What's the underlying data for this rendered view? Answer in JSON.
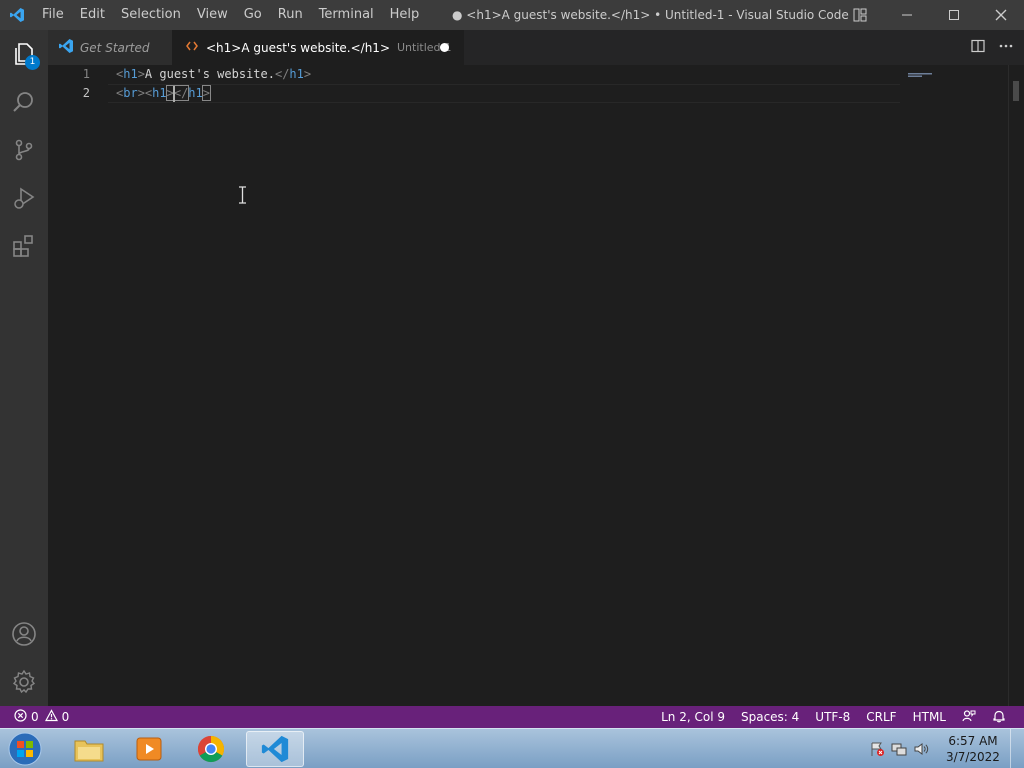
{
  "titlebar": {
    "menu": [
      "File",
      "Edit",
      "Selection",
      "View",
      "Go",
      "Run",
      "Terminal",
      "Help"
    ],
    "window_title": "● <h1>A guest's website.</h1> • Untitled-1 - Visual Studio Code"
  },
  "activitybar": {
    "explorer_badge": "1",
    "icons": [
      "files-icon",
      "search-icon",
      "source-control-icon",
      "run-debug-icon",
      "extensions-icon",
      "account-icon",
      "settings-gear-icon"
    ]
  },
  "tabs": [
    {
      "label": "Get Started",
      "active": false
    },
    {
      "label": "<h1>A guest's website.</h1>",
      "description": "Untitled-1",
      "active": true,
      "dirty": true
    }
  ],
  "editor": {
    "line_numbers": [
      "1",
      "2"
    ],
    "lines": [
      {
        "open_lt": "<",
        "open_tag": "h1",
        "open_gt": ">",
        "text": "A guest's website.",
        "close_lt": "</",
        "close_tag": "h1",
        "close_gt": ">"
      },
      {
        "br_lt": "<",
        "br_tag": "br",
        "br_gt": ">",
        "h1_lt": "<",
        "h1_tag": "h1",
        "h1_gt": ">",
        "close_lt": "</",
        "close_tag": "h1",
        "close_gt": ">"
      }
    ]
  },
  "statusbar": {
    "errors": "0",
    "warnings": "0",
    "position": "Ln 2, Col 9",
    "spaces": "Spaces: 4",
    "encoding": "UTF-8",
    "eol": "CRLF",
    "language": "HTML",
    "background": "#68217a"
  },
  "taskbar": {
    "apps": [
      "file-explorer-icon",
      "media-player-icon",
      "chrome-icon",
      "vscode-icon"
    ],
    "clock_time": "6:57 AM",
    "clock_date": "3/7/2022"
  }
}
